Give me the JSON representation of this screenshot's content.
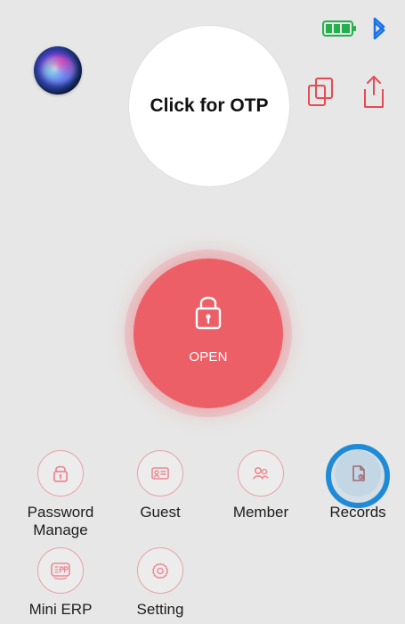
{
  "status": {
    "battery": {
      "icon": "battery-icon",
      "color": "#22b14c"
    },
    "bluetooth": {
      "icon": "bluetooth-icon",
      "color": "#1a73e8"
    }
  },
  "header": {
    "siri": {
      "icon": "siri-icon"
    },
    "otp_label": "Click for OTP",
    "actions": {
      "copy": {
        "icon": "copy-icon",
        "color": "#e44b55"
      },
      "share": {
        "icon": "share-icon",
        "color": "#e44b55"
      }
    }
  },
  "main": {
    "open_button": {
      "label": "OPEN",
      "icon": "lock-icon",
      "color": "#ec5f67"
    }
  },
  "menu": {
    "items": [
      {
        "label": "Password\nManage",
        "icon": "lock-icon"
      },
      {
        "label": "Guest",
        "icon": "id-card-icon"
      },
      {
        "label": "Member",
        "icon": "users-icon"
      },
      {
        "label": "Records",
        "icon": "records-icon",
        "highlight": "#1f8bd6"
      },
      {
        "label": "Mini ERP",
        "icon": "erp-icon"
      },
      {
        "label": "Setting",
        "icon": "gear-icon"
      }
    ]
  }
}
